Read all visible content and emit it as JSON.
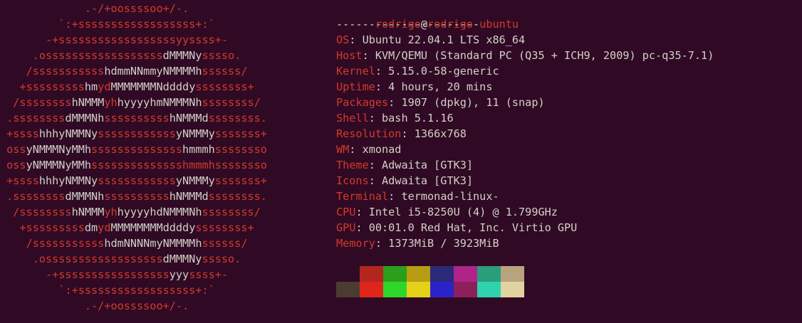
{
  "logo": {
    "lines": [
      [
        [
          "r",
          "             .-/+oossssoo+/-.               "
        ]
      ],
      [
        [
          "r",
          "         `:+ssssssssssssssssss+:`           "
        ]
      ],
      [
        [
          "r",
          "       -+ssssssssssssssssssyyssss+-         "
        ]
      ],
      [
        [
          "r",
          "     .ossssssssssssssssss"
        ],
        [
          "w",
          "dMMMNy"
        ],
        [
          "r",
          "sssso.       "
        ]
      ],
      [
        [
          "r",
          "    /sssssssssss"
        ],
        [
          "w",
          "hdmmNNmmyNMMMMh"
        ],
        [
          "r",
          "ssssss/      "
        ]
      ],
      [
        [
          "r",
          "   +sssssssss"
        ],
        [
          "w",
          "hm"
        ],
        [
          "r",
          "yd"
        ],
        [
          "w",
          "MMMMMMMNddddy"
        ],
        [
          "r",
          "ssssssss+     "
        ]
      ],
      [
        [
          "r",
          "  /ssssssss"
        ],
        [
          "w",
          "hNMMM"
        ],
        [
          "r",
          "yh"
        ],
        [
          "w",
          "hyyyyhmNMMMNh"
        ],
        [
          "r",
          "ssssssss/    "
        ]
      ],
      [
        [
          "r",
          " .ssssssss"
        ],
        [
          "w",
          "dMMMNh"
        ],
        [
          "r",
          "ssssssssss"
        ],
        [
          "w",
          "hNMMMd"
        ],
        [
          "r",
          "ssssssss.   "
        ]
      ],
      [
        [
          "r",
          " +ssss"
        ],
        [
          "w",
          "hhhyNMMNy"
        ],
        [
          "r",
          "ssssssssssss"
        ],
        [
          "w",
          "yNMMMy"
        ],
        [
          "r",
          "sssssss+   "
        ]
      ],
      [
        [
          "r",
          " oss"
        ],
        [
          "w",
          "yNMMMNyMMh"
        ],
        [
          "r",
          "ssssssssssssss"
        ],
        [
          "w",
          "hmmmh"
        ],
        [
          "r",
          "ssssssso   "
        ]
      ],
      [
        [
          "r",
          " oss"
        ],
        [
          "w",
          "yNMMMNyMMh"
        ],
        [
          "r",
          "sssssssssssssshmmmhssssssso   "
        ]
      ],
      [
        [
          "r",
          " +ssss"
        ],
        [
          "w",
          "hhhyNMMNy"
        ],
        [
          "r",
          "ssssssssssss"
        ],
        [
          "w",
          "yNMMMy"
        ],
        [
          "r",
          "sssssss+   "
        ]
      ],
      [
        [
          "r",
          " .ssssssss"
        ],
        [
          "w",
          "dMMMNh"
        ],
        [
          "r",
          "ssssssssss"
        ],
        [
          "w",
          "hNMMMd"
        ],
        [
          "r",
          "ssssssss.   "
        ]
      ],
      [
        [
          "r",
          "  /ssssssss"
        ],
        [
          "w",
          "hNMMM"
        ],
        [
          "r",
          "yh"
        ],
        [
          "w",
          "hyyyyhdNMMMNh"
        ],
        [
          "r",
          "ssssssss/    "
        ]
      ],
      [
        [
          "r",
          "   +sssssssss"
        ],
        [
          "w",
          "dm"
        ],
        [
          "r",
          "yd"
        ],
        [
          "w",
          "MMMMMMMMddddy"
        ],
        [
          "r",
          "ssssssss+     "
        ]
      ],
      [
        [
          "r",
          "    /sssssssssss"
        ],
        [
          "w",
          "hdmNNNNmyNMMMMh"
        ],
        [
          "r",
          "ssssss/      "
        ]
      ],
      [
        [
          "r",
          "     .ossssssssssssssssss"
        ],
        [
          "w",
          "dMMMNy"
        ],
        [
          "r",
          "sssso.       "
        ]
      ],
      [
        [
          "r",
          "       -+sssssssssssssssss"
        ],
        [
          "w",
          "yyy"
        ],
        [
          "r",
          "ssss+-         "
        ]
      ],
      [
        [
          "r",
          "         `:+ssssssssssssssssss+:`           "
        ]
      ],
      [
        [
          "r",
          "             .-/+oossssoo+/-.               "
        ]
      ]
    ]
  },
  "info": {
    "user": "rodrigo",
    "at": "@",
    "host": "rodrigo-ubuntu",
    "separator": "----------------------",
    "fields": [
      {
        "key": "OS",
        "sep": ": ",
        "value": "Ubuntu 22.04.1 LTS x86_64"
      },
      {
        "key": "Host",
        "sep": ": ",
        "value": "KVM/QEMU (Standard PC (Q35 + ICH9, 2009) pc-q35-7.1)"
      },
      {
        "key": "Kernel",
        "sep": ": ",
        "value": "5.15.0-58-generic"
      },
      {
        "key": "Uptime",
        "sep": ": ",
        "value": "4 hours, 20 mins"
      },
      {
        "key": "Packages",
        "sep": ": ",
        "value": "1907 (dpkg), 11 (snap)"
      },
      {
        "key": "Shell",
        "sep": ": ",
        "value": "bash 5.1.16"
      },
      {
        "key": "Resolution",
        "sep": ": ",
        "value": "1366x768"
      },
      {
        "key": "WM",
        "sep": ": ",
        "value": "xmonad"
      },
      {
        "key": "Theme",
        "sep": ": ",
        "value": "Adwaita [GTK3]"
      },
      {
        "key": "Icons",
        "sep": ": ",
        "value": "Adwaita [GTK3]"
      },
      {
        "key": "Terminal",
        "sep": ": ",
        "value": "termonad-linux-"
      },
      {
        "key": "CPU",
        "sep": ": ",
        "value": "Intel i5-8250U (4) @ 1.799GHz"
      },
      {
        "key": "GPU",
        "sep": ": ",
        "value": "00:01.0 Red Hat, Inc. Virtio GPU"
      },
      {
        "key": "Memory",
        "sep": ": ",
        "value": "1373MiB / 3923MiB"
      }
    ]
  },
  "palette": {
    "top": [
      "#300a24",
      "#b3261e",
      "#2b9e1c",
      "#b89c12",
      "#2a2a78",
      "#b02489",
      "#2a9d7a",
      "#b8a37e"
    ],
    "bottom": [
      "#4a3c30",
      "#e0261c",
      "#2ed62a",
      "#e5d01a",
      "#2a24c8",
      "#8c1f5c",
      "#2ed3ae",
      "#e0d3a0"
    ]
  },
  "colors": {
    "background": "#300a24",
    "accent": "#d23a2c",
    "text": "#d3d0c8"
  }
}
